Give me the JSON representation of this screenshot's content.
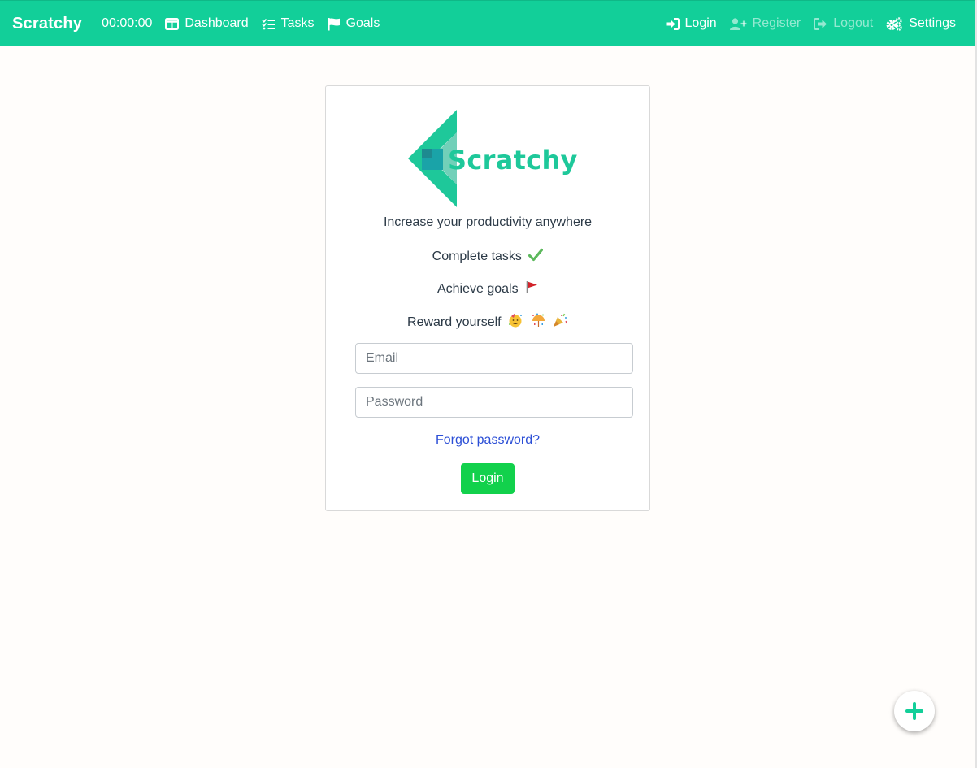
{
  "navbar": {
    "brand": "Scratchy",
    "timer": "00:00:00",
    "left_items": [
      {
        "label": "Dashboard",
        "icon": "columns-icon"
      },
      {
        "label": "Tasks",
        "icon": "tasks-icon"
      },
      {
        "label": "Goals",
        "icon": "flag-icon"
      }
    ],
    "right_items": [
      {
        "label": "Login",
        "icon": "sign-in-icon"
      },
      {
        "label": "Register",
        "icon": "user-plus-icon"
      },
      {
        "label": "Logout",
        "icon": "sign-out-icon"
      },
      {
        "label": "Settings",
        "icon": "cogs-icon"
      }
    ]
  },
  "login_card": {
    "logo_text": "Scratchy",
    "tagline": "Increase your productivity anywhere",
    "features": [
      {
        "text": "Complete tasks",
        "emoji": "check-mark-emoji"
      },
      {
        "text": "Achieve goals",
        "emoji": "red-flag-emoji"
      },
      {
        "text": "Reward yourself",
        "emoji": "party-emojis"
      }
    ],
    "email_placeholder": "Email",
    "password_placeholder": "Password",
    "forgot_password": "Forgot password?",
    "login_button": "Login"
  },
  "colors": {
    "brand_green": "#12cf99",
    "login_button": "#12d14c",
    "link_blue": "#2c4fd6"
  },
  "fab": {
    "icon": "plus-icon"
  }
}
